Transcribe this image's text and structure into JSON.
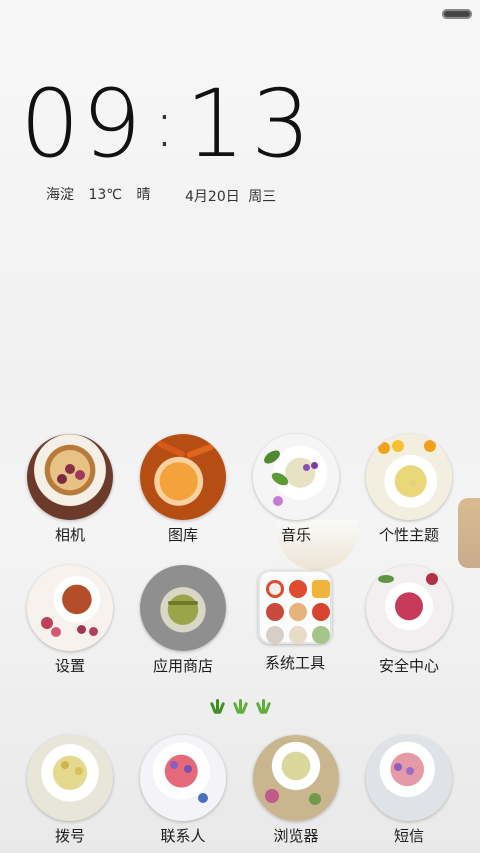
{
  "clock": {
    "hours": "09",
    "separator": ":",
    "minutes": "13"
  },
  "weather": {
    "location": "海淀",
    "temperature": "13℃",
    "condition": "晴"
  },
  "date": {
    "day": "4月20日",
    "weekday": "周三"
  },
  "apps_row1": [
    {
      "label": "相机",
      "icon": "tea-cup-roses-icon",
      "colors": [
        "#6b3a2a",
        "#e7c287"
      ]
    },
    {
      "label": "图库",
      "icon": "tea-cup-orange-icon",
      "colors": [
        "#c55b18",
        "#f4a23b"
      ]
    },
    {
      "label": "音乐",
      "icon": "tea-cup-violet-icon",
      "colors": [
        "#ffffff",
        "#cfd9b0"
      ]
    },
    {
      "label": "个性主题",
      "icon": "tea-cup-chamomile-icon",
      "colors": [
        "#f3efe0",
        "#e9d77a"
      ]
    }
  ],
  "apps_row2": [
    {
      "label": "设置",
      "icon": "tea-cup-red-icon",
      "colors": [
        "#ffffff",
        "#b44d2a"
      ]
    },
    {
      "label": "应用商店",
      "icon": "tea-cup-herbal-icon",
      "colors": [
        "#8f8f8f",
        "#9aa54a"
      ]
    },
    {
      "label": "系统工具",
      "icon": "folder-icon",
      "colors": [
        "#ffffff",
        "#e04a2f"
      ]
    },
    {
      "label": "安全中心",
      "icon": "tea-cup-rose-pink-icon",
      "colors": [
        "#ffffff",
        "#c73a5a"
      ]
    }
  ],
  "dock": [
    {
      "label": "拨号",
      "icon": "tea-cup-yellow-icon",
      "colors": [
        "#e8e6d8",
        "#e5d98f"
      ]
    },
    {
      "label": "联系人",
      "icon": "tea-cup-pink-icon",
      "colors": [
        "#ffffff",
        "#e46a7b"
      ]
    },
    {
      "label": "浏览器",
      "icon": "tea-cup-green-icon",
      "colors": [
        "#c9b68f",
        "#d9d79a"
      ]
    },
    {
      "label": "短信",
      "icon": "tea-cup-rose-icon",
      "colors": [
        "#dfe3e8",
        "#e59aa7"
      ]
    }
  ],
  "page_indicator": {
    "pages": 3,
    "current": 1
  }
}
